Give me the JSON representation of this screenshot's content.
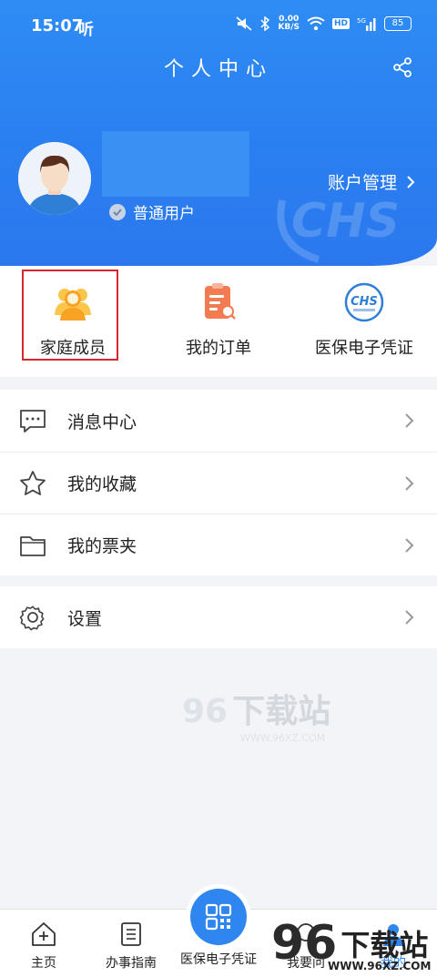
{
  "status": {
    "time": "15:07",
    "carrier_glyph": "听",
    "net_speed_top": "0.00",
    "net_speed_unit": "KB/S",
    "hd": "HD",
    "signal": "5G",
    "battery": "85"
  },
  "header": {
    "title": "个人中心",
    "user_type": "普通用户",
    "account_mgmt": "账户管理"
  },
  "quick_actions": [
    {
      "label": "家庭成员",
      "icon": "family-icon"
    },
    {
      "label": "我的订单",
      "icon": "order-icon"
    },
    {
      "label": "医保电子凭证",
      "icon": "chs-icon"
    }
  ],
  "menu_group1": [
    {
      "label": "消息中心",
      "icon": "message-icon"
    },
    {
      "label": "我的收藏",
      "icon": "star-icon"
    },
    {
      "label": "我的票夹",
      "icon": "folder-icon"
    }
  ],
  "menu_group2": [
    {
      "label": "设置",
      "icon": "settings-icon"
    }
  ],
  "watermark": {
    "mid_num": "96",
    "mid_text": "下载站",
    "mid_url": "WWW.96XZ.COM",
    "corner_num": "96",
    "corner_text": "下载站",
    "corner_url": "WWW.96XZ.COM"
  },
  "nav": {
    "home": "主页",
    "guide": "办事指南",
    "ecert": "医保电子凭证",
    "service": "我要问",
    "mine": "我的"
  },
  "colors": {
    "primary": "#2f86ef",
    "highlight_border": "#d9262b"
  }
}
